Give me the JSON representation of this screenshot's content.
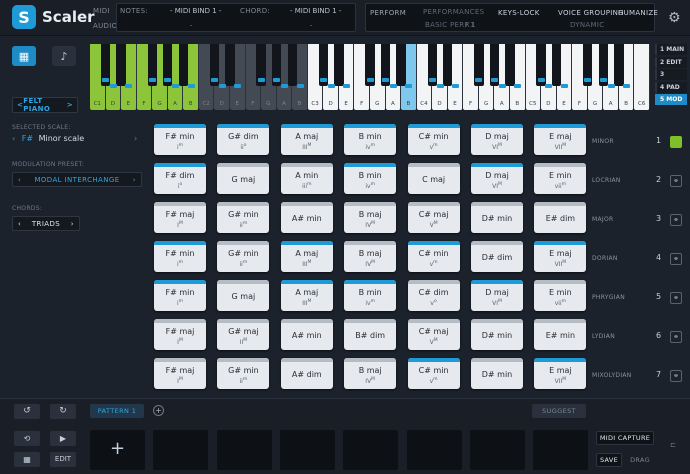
{
  "app": {
    "name": "Scaler",
    "logo_letter": "S"
  },
  "topbar": {
    "midi_label": "MIDI",
    "audio_label": "AUDIO",
    "notes_label": "NOTES:",
    "notes_value": "- MIDI BIND 1 -",
    "chord_label": "CHORD:",
    "chord_value": "- MIDI BIND 1 -",
    "dot": ".",
    "perform_label": "PERFORM",
    "performances_label": "PERFORMANCES",
    "performance_value": "BASIC PERF 1",
    "x1_label": "X1",
    "keys_lock_label": "KEYS-LOCK",
    "voice_grouping_label": "VOICE GROUPING",
    "voice_grouping_value": "DYNAMIC",
    "humanize_label": "HUMANIZE"
  },
  "instrument": {
    "preset": "FELT PIANO",
    "arrow_left": "<",
    "arrow_right": ">"
  },
  "keyboard": {
    "white_keys": [
      "C1",
      "D",
      "E",
      "F",
      "G",
      "A",
      "B",
      "C2",
      "D",
      "E",
      "F",
      "G",
      "A",
      "B",
      "C3",
      "D",
      "E",
      "F",
      "G",
      "A",
      "B",
      "C4",
      "D",
      "E",
      "F",
      "G",
      "A",
      "B",
      "C5",
      "D",
      "E",
      "F",
      "G",
      "A",
      "B",
      "C6"
    ],
    "colors": {
      "green": "#8cc43a",
      "dark": "#434a53",
      "white": "#f2f4f6",
      "light_blue": "#7ec8ee",
      "blue": "#1e9ad6"
    }
  },
  "nav": [
    {
      "label": "1 MAIN"
    },
    {
      "label": "2 EDIT"
    },
    {
      "label": "3 CHORD"
    },
    {
      "label": "4 PAD"
    },
    {
      "label": "5 MOD"
    }
  ],
  "sidebar": {
    "selected_scale_label": "SELECTED SCALE:",
    "scale_key": "F#",
    "scale_name": "Minor scale",
    "modulation_label": "MODULATION PRESET:",
    "modulation_value": "MODAL INTERCHANGE",
    "chords_label": "CHORDS:",
    "chords_value": "TRIADS"
  },
  "modes": [
    {
      "label": "MINOR",
      "num": "1",
      "chords": [
        {
          "name": "F# min",
          "deg": "i",
          "sup": "m",
          "bar": "blue"
        },
        {
          "name": "G# dim",
          "deg": "ii",
          "sup": "o",
          "bar": "blue"
        },
        {
          "name": "A maj",
          "deg": "III",
          "sup": "M",
          "bar": "blue"
        },
        {
          "name": "B min",
          "deg": "iv",
          "sup": "m",
          "bar": "blue"
        },
        {
          "name": "C# min",
          "deg": "v",
          "sup": "m",
          "bar": "blue"
        },
        {
          "name": "D maj",
          "deg": "VI",
          "sup": "M",
          "bar": "blue"
        },
        {
          "name": "E maj",
          "deg": "VII",
          "sup": "M",
          "bar": "blue"
        }
      ]
    },
    {
      "label": "LOCRIAN",
      "num": "2",
      "chords": [
        {
          "name": "F# dim",
          "deg": "i",
          "sup": "o",
          "bar": "blue"
        },
        {
          "name": "G maj",
          "deg": "",
          "sup": "",
          "bar": "grey"
        },
        {
          "name": "A min",
          "deg": "iii",
          "sup": "m",
          "bar": "grey"
        },
        {
          "name": "B min",
          "deg": "iv",
          "sup": "m",
          "bar": "blue"
        },
        {
          "name": "C maj",
          "deg": "",
          "sup": "",
          "bar": "grey"
        },
        {
          "name": "D maj",
          "deg": "VI",
          "sup": "M",
          "bar": "blue"
        },
        {
          "name": "E min",
          "deg": "vii",
          "sup": "m",
          "bar": "grey"
        }
      ]
    },
    {
      "label": "MAJOR",
      "num": "3",
      "chords": [
        {
          "name": "F# maj",
          "deg": "I",
          "sup": "M",
          "bar": "grey"
        },
        {
          "name": "G# min",
          "deg": "ii",
          "sup": "m",
          "bar": "grey"
        },
        {
          "name": "A# min",
          "deg": "",
          "sup": "",
          "bar": "grey"
        },
        {
          "name": "B maj",
          "deg": "IV",
          "sup": "M",
          "bar": "grey"
        },
        {
          "name": "C# maj",
          "deg": "V",
          "sup": "M",
          "bar": "grey"
        },
        {
          "name": "D# min",
          "deg": "",
          "sup": "",
          "bar": "grey"
        },
        {
          "name": "E# dim",
          "deg": "",
          "sup": "",
          "bar": "grey"
        }
      ]
    },
    {
      "label": "DORIAN",
      "num": "4",
      "chords": [
        {
          "name": "F# min",
          "deg": "i",
          "sup": "m",
          "bar": "blue"
        },
        {
          "name": "G# min",
          "deg": "ii",
          "sup": "m",
          "bar": "grey"
        },
        {
          "name": "A maj",
          "deg": "III",
          "sup": "M",
          "bar": "blue"
        },
        {
          "name": "B maj",
          "deg": "IV",
          "sup": "M",
          "bar": "grey"
        },
        {
          "name": "C# min",
          "deg": "v",
          "sup": "m",
          "bar": "blue"
        },
        {
          "name": "D# dim",
          "deg": "",
          "sup": "",
          "bar": "grey"
        },
        {
          "name": "E maj",
          "deg": "VII",
          "sup": "M",
          "bar": "blue"
        }
      ]
    },
    {
      "label": "PHRYGIAN",
      "num": "5",
      "chords": [
        {
          "name": "F# min",
          "deg": "i",
          "sup": "m",
          "bar": "blue"
        },
        {
          "name": "G maj",
          "deg": "",
          "sup": "",
          "bar": "grey"
        },
        {
          "name": "A maj",
          "deg": "III",
          "sup": "M",
          "bar": "blue"
        },
        {
          "name": "B min",
          "deg": "iv",
          "sup": "m",
          "bar": "blue"
        },
        {
          "name": "C# dim",
          "deg": "v",
          "sup": "o",
          "bar": "grey"
        },
        {
          "name": "D maj",
          "deg": "VI",
          "sup": "M",
          "bar": "blue"
        },
        {
          "name": "E min",
          "deg": "vii",
          "sup": "m",
          "bar": "grey"
        }
      ]
    },
    {
      "label": "LYDIAN",
      "num": "6",
      "chords": [
        {
          "name": "F# maj",
          "deg": "I",
          "sup": "M",
          "bar": "grey"
        },
        {
          "name": "G# maj",
          "deg": "II",
          "sup": "M",
          "bar": "grey"
        },
        {
          "name": "A# min",
          "deg": "",
          "sup": "",
          "bar": "grey"
        },
        {
          "name": "B# dim",
          "deg": "",
          "sup": "",
          "bar": "grey"
        },
        {
          "name": "C# maj",
          "deg": "V",
          "sup": "M",
          "bar": "grey"
        },
        {
          "name": "D# min",
          "deg": "",
          "sup": "",
          "bar": "grey"
        },
        {
          "name": "E# min",
          "deg": "",
          "sup": "",
          "bar": "grey"
        }
      ]
    },
    {
      "label": "MIXOLYDIAN",
      "num": "7",
      "chords": [
        {
          "name": "F# maj",
          "deg": "I",
          "sup": "M",
          "bar": "grey"
        },
        {
          "name": "G# min",
          "deg": "ii",
          "sup": "m",
          "bar": "grey"
        },
        {
          "name": "A# dim",
          "deg": "",
          "sup": "",
          "bar": "grey"
        },
        {
          "name": "B maj",
          "deg": "IV",
          "sup": "M",
          "bar": "grey"
        },
        {
          "name": "C# min",
          "deg": "v",
          "sup": "m",
          "bar": "blue"
        },
        {
          "name": "D# min",
          "deg": "",
          "sup": "",
          "bar": "grey"
        },
        {
          "name": "E maj",
          "deg": "VII",
          "sup": "M",
          "bar": "blue"
        }
      ]
    }
  ],
  "bottom": {
    "pattern_label": "PATTERN 1",
    "add_symbol": "+",
    "suggest_label": "SUGGEST",
    "plus_pad": "+",
    "midi_capture_label": "MIDI CAPTURE",
    "save_label": "SAVE",
    "drag_label": "DRAG",
    "edit_label": "EDIT"
  }
}
